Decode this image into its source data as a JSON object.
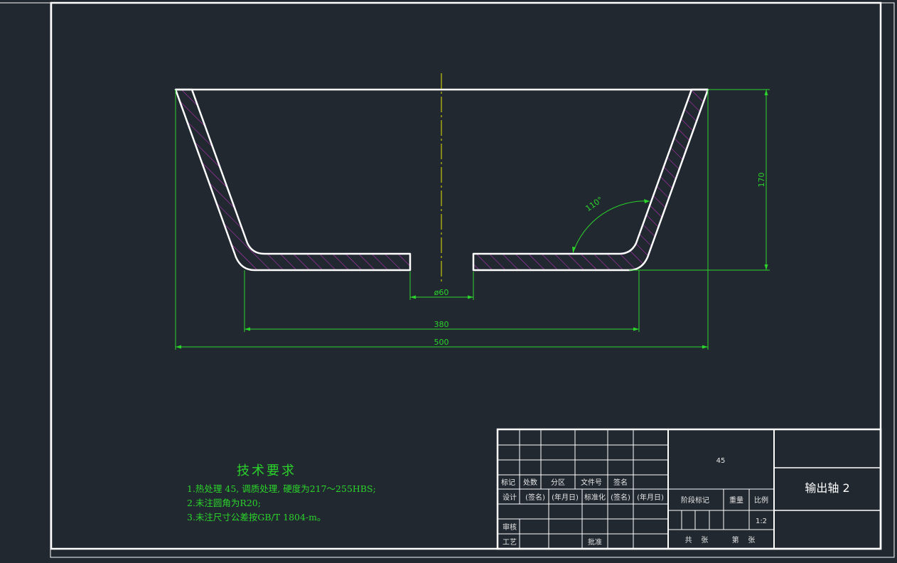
{
  "drawing": {
    "dimensions": {
      "total_width": "500",
      "bottom_width": "380",
      "hole_diameter": "ø60",
      "height": "170",
      "angle": "110°"
    },
    "colors": {
      "background": "#212830",
      "outline": "#ffffff",
      "dimension": "#2bd42b",
      "hatch": "#c531c5",
      "centerline": "#e6e600"
    }
  },
  "technical_requirements": {
    "title": "技术要求",
    "items": [
      "1.热处理 45, 调质处理, 硬度为217～255HBS;",
      "2.未注圆角为R20;",
      "3.未注尺寸公差按GB/T 1804-m。"
    ]
  },
  "title_block": {
    "material": "45",
    "part_name": "输出轴 2",
    "row_labels": {
      "mark": "标记",
      "count": "处数",
      "zone": "分区",
      "doc_no": "文件号",
      "sign": "签名",
      "design": "设计",
      "signature": "(签名)",
      "date": "(年月日)",
      "standardize": "标准化",
      "signature2": "(签名)",
      "date2": "(年月日)",
      "review": "审核",
      "process": "工艺",
      "approve": "批准"
    },
    "stage_mark": "阶段标记",
    "weight": "重量",
    "scale_label": "比例",
    "scale": "1:2",
    "sheets_total": "共    张",
    "sheet_no": "第    张"
  }
}
